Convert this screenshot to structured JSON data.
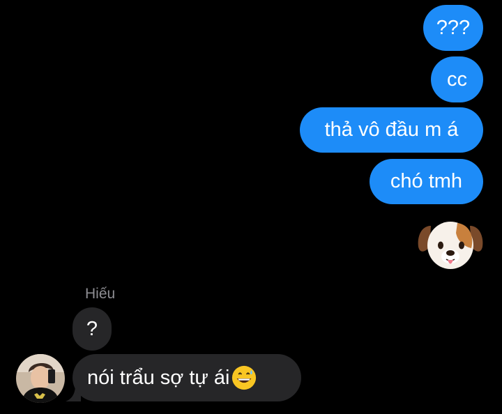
{
  "conversation": {
    "sent_messages": [
      {
        "text": "???"
      },
      {
        "text": "cc"
      },
      {
        "text": "thả vô đầu m á"
      },
      {
        "text": "chó tmh"
      }
    ],
    "sent_emoji": "dog-face-emoji",
    "received": {
      "sender_name": "Hiếu",
      "messages": [
        {
          "text": "?"
        },
        {
          "text": "nói trẩu sợ tự ái",
          "trailing_emoji": "grinning-face-with-sweat-emoji"
        }
      ]
    }
  },
  "colors": {
    "background": "#000000",
    "sent_bubble": "#1d8cf8",
    "received_bubble": "#262628",
    "sender_name": "#8e8e93"
  }
}
